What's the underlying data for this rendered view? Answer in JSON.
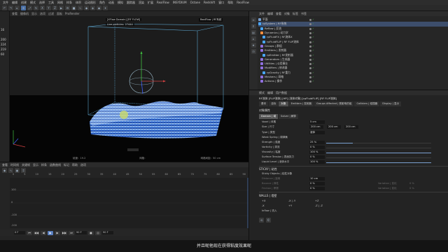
{
  "colors": {
    "accent": "#4a6fa5",
    "selection": "#3d4e6c",
    "check_green": "#4caf50",
    "particle_blue": "#2f6fe0",
    "particle_light": "#a8d4ff",
    "bbox_line": "#5aa0c8",
    "axis_x": "#d04040",
    "axis_y": "#40c040",
    "axis_z": "#4060ff"
  },
  "menubar": {
    "items": [
      "文件",
      "编辑",
      "创建",
      "模式",
      "选择",
      "工具",
      "网格",
      "样条",
      "体积",
      "运动图形",
      "角色",
      "动画",
      "模拟",
      "跟踪器",
      "渲染",
      "扩展",
      "RealFlow",
      "INSYDIUM",
      "Octane",
      "Redshift",
      "窗口",
      "帮助",
      "RealFlow"
    ]
  },
  "left_strip": {
    "values": [
      "16",
      "200",
      "224",
      "219",
      "60"
    ]
  },
  "viewport": {
    "header": [
      "查看",
      "摄像机",
      "显示",
      "选项",
      "过滤",
      "面板",
      "ProRender"
    ],
    "label_particles": "Live particles: 27444",
    "label_object": "[XFlow Domain] [RF FLOW]",
    "label_system": "RealFlow | RF系统",
    "footer_left": "帧速：19.2",
    "footer_mid": "网格：",
    "footer_right": "网格间距：50 cm"
  },
  "timeline": {
    "menu": [
      "查看",
      "时间线",
      "关键帧",
      "显示",
      "样条",
      "函数曲线",
      "标记",
      "帮助",
      "选项"
    ],
    "ruler": [
      "0",
      "5",
      "10",
      "15",
      "20",
      "25",
      "30",
      "35",
      "40",
      "45",
      "50",
      "55",
      "60",
      "65",
      "70",
      "75",
      "80",
      "85",
      "90"
    ],
    "ylabels": [
      "100",
      "0",
      "-100",
      "-200"
    ],
    "current_frame": "90 F",
    "end_frame": "90 F",
    "fps": "0 F"
  },
  "subtitle": "并且呢他现在获得粘度效果呢",
  "objects": {
    "tabs": [
      "文件",
      "编辑",
      "查看",
      "对象",
      "标签",
      "书签"
    ],
    "rows": [
      {
        "name": "平面",
        "indent": 0,
        "color": "#7aa0d0",
        "sel": false
      },
      {
        "name": "rpSystem | RF系统",
        "indent": 0,
        "color": "#4aa8ff",
        "sel": true
      },
      {
        "name": "Reflow | 反流",
        "indent": 3,
        "color": "#4aa8ff",
        "sel": false
      },
      {
        "name": "Dynamics | 动力学",
        "indent": 3,
        "color": "#ff9040",
        "sel": false
      },
      {
        "name": "rpFluidFX | RF流体X",
        "indent": 6,
        "color": "#4aa8ff",
        "sel": false
      },
      {
        "name": "rpFluidFLIP | RF FLIP流体",
        "indent": 6,
        "color": "#4aa8ff",
        "sel": false
      },
      {
        "name": "Groups | 群组",
        "indent": 3,
        "color": "#9070e0",
        "sel": false
      },
      {
        "name": "Emitters | 发射器",
        "indent": 3,
        "color": "#9070e0",
        "sel": false
      },
      {
        "name": "rpEmitter | RF发射器",
        "indent": 6,
        "color": "#4aa8ff",
        "sel": false
      },
      {
        "name": "Generators | 生成器",
        "indent": 3,
        "color": "#9070e0",
        "sel": false
      },
      {
        "name": "Utilities | 公用事业",
        "indent": 3,
        "color": "#9070e0",
        "sel": false
      },
      {
        "name": "Modifiers | 修改器",
        "indent": 3,
        "color": "#9070e0",
        "sel": false
      },
      {
        "name": "rpGravity | RF重力",
        "indent": 6,
        "color": "#4aa8ff",
        "sel": false
      },
      {
        "name": "Meshers | 网格",
        "indent": 3,
        "color": "#9070e0",
        "sel": false
      },
      {
        "name": "Actions | 操作",
        "indent": 3,
        "color": "#9070e0",
        "sel": false
      }
    ]
  },
  "attributes": {
    "menu": [
      "模式",
      "编辑",
      "用户数据"
    ],
    "object_title": "RF流体 [FLIP流体] [HP] [流体对象] [rpFluidFLIP] [RF FLIP流体]",
    "tabs": [
      "基本",
      "坐标",
      "对象",
      "Emitters | 发射器",
      "Groups Affected | 受影响的组",
      "Colliders | 碰撞器",
      "Display | 显示"
    ],
    "active_tab": "对象",
    "section_title": "对象属性",
    "subtabs": [
      "Domain | 域",
      "Solver | 解算"
    ],
    "active_subtab": "Domain | 域",
    "voxel": {
      "label": "Voxel | 体素",
      "value": "5 cm"
    },
    "size": {
      "label": "Size | 尺寸",
      "x": "200 cm",
      "y": "200 cm",
      "z": "200 cm"
    },
    "props": [
      {
        "label": "Type | 类型",
        "value": "液体",
        "pct": null
      },
      {
        "label": "Weak Spring | 弱弹簧",
        "value": "",
        "pct": null
      },
      {
        "label": "Strength | 强度",
        "value": "25 %",
        "pct": 0.25
      },
      {
        "label": "Vorticity | 涡流",
        "value": "0 %",
        "pct": 0.0
      },
      {
        "label": "Viscosity | 粘度",
        "value": "100 %",
        "pct": 1.0
      },
      {
        "label": "Surface Tension | 表面张力",
        "value": "0 %",
        "pct": 0.0
      },
      {
        "label": "Liquid Level | 液体水平",
        "value": "100 %",
        "pct": 1.0
      }
    ],
    "sticky_title": "STICKY | 粘性",
    "sticky": [
      {
        "label": "Sticky Objects | 粘性对象"
      },
      {
        "label": "Distance | 距离",
        "value": "10 cm"
      },
      {
        "label": "Bounce | 弹性",
        "value": "0 %",
        "right_label": "Variation | 变化",
        "right_value": "0 %"
      },
      {
        "label": "Friction | 摩擦",
        "value": "0 %",
        "right_label": "Variation | 变化",
        "right_value": "0 %"
      }
    ],
    "walls_title": "WALLS | 墙壁",
    "walls": [
      {
        "a": "+X",
        "b": "-X | -Y",
        "c": "+Z"
      },
      {
        "a": "-X",
        "b": "+Y",
        "c": "-Z | -Z"
      },
      {
        "a": "Inflow | 流入",
        "b": "",
        "c": ""
      }
    ]
  }
}
